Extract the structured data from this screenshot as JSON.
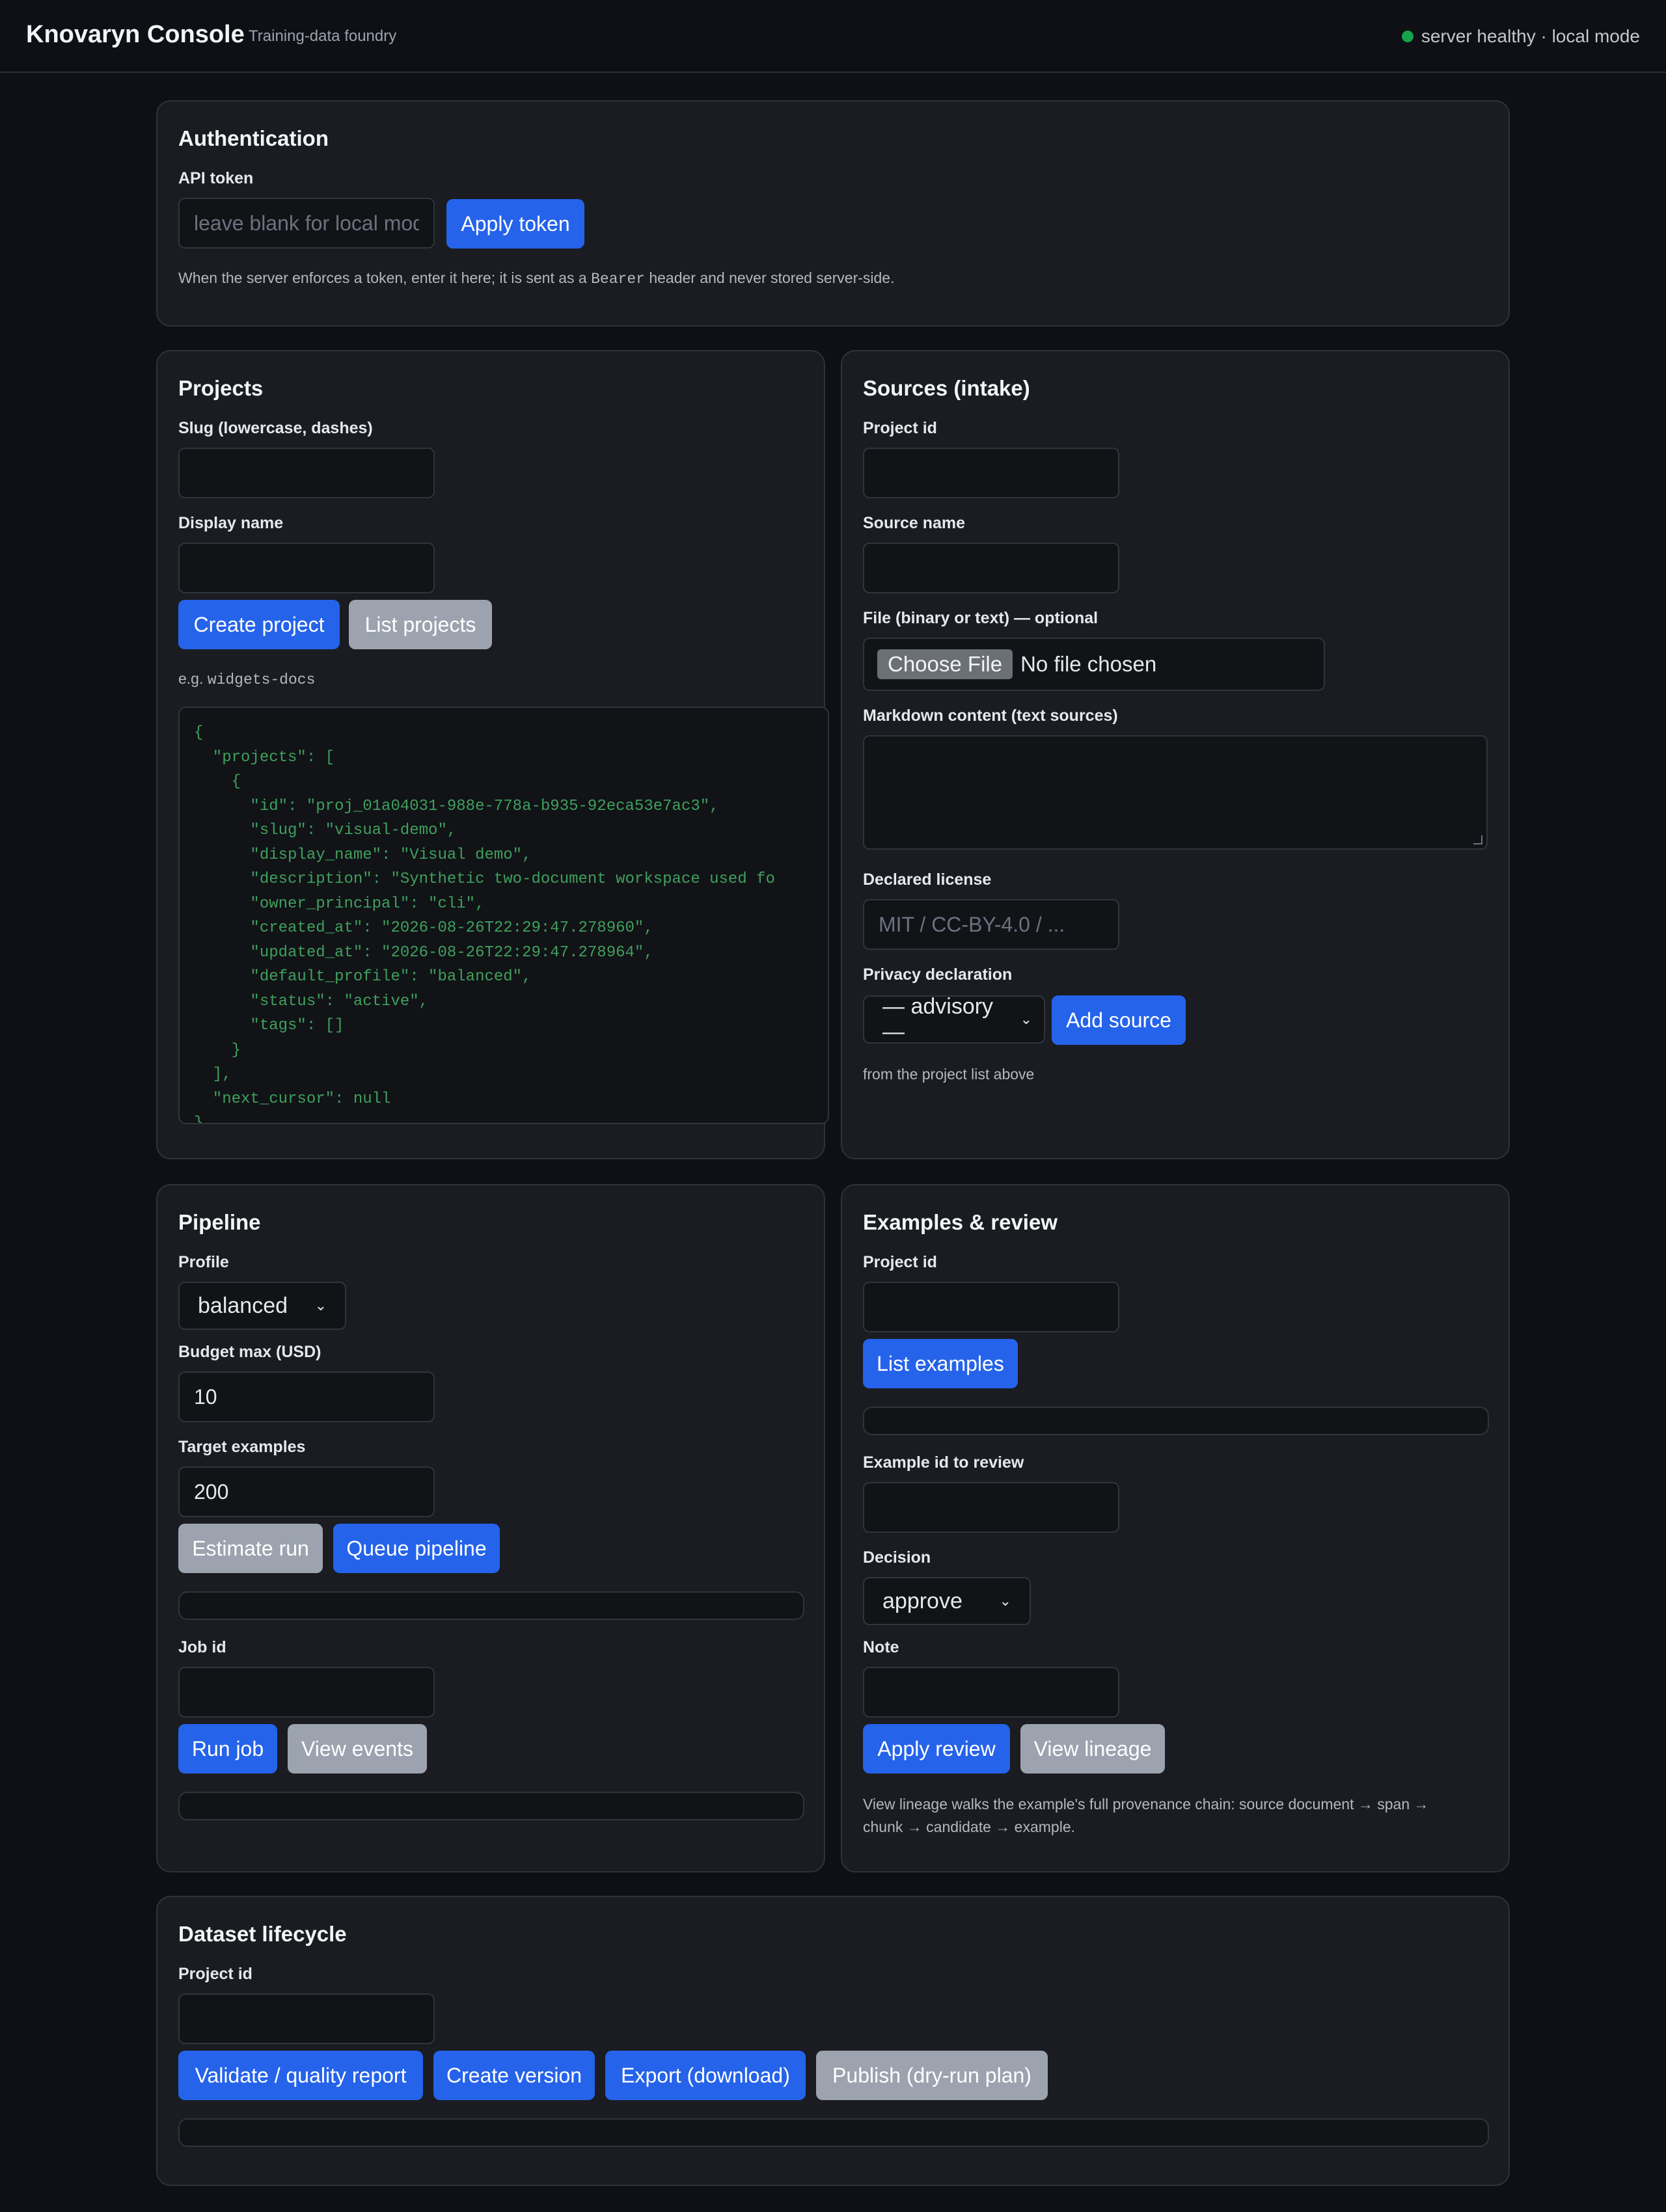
{
  "header": {
    "brand": "Knovaryn Console",
    "tagline": "Training-data foundry",
    "status": "server healthy · local mode",
    "status_color": "#16a34a"
  },
  "auth": {
    "title": "Authentication",
    "token_label": "API token",
    "token_placeholder": "leave blank for local mode",
    "apply_label": "Apply token",
    "hint_before": "When the server enforces a token, enter it here; it is sent as a ",
    "hint_code": "Bearer",
    "hint_after": " header and never stored server-side."
  },
  "projects": {
    "title": "Projects",
    "slug_label": "Slug (lowercase, dashes)",
    "display_label": "Display name",
    "create_label": "Create project",
    "list_label": "List projects",
    "hint_prefix": "e.g. ",
    "hint_code": "widgets-docs",
    "json_lines": [
      "{",
      "  \"projects\": [",
      "    {",
      "      \"id\": \"proj_01a04031-988e-778a-b935-92eca53e7ac3\",",
      "      \"slug\": \"visual-demo\",",
      "      \"display_name\": \"Visual demo\",",
      "      \"description\": \"Synthetic two-document workspace used fo",
      "      \"owner_principal\": \"cli\",",
      "      \"created_at\": \"2026-08-26T22:29:47.278960\",",
      "      \"updated_at\": \"2026-08-26T22:29:47.278964\",",
      "      \"default_profile\": \"balanced\",",
      "      \"status\": \"active\",",
      "      \"tags\": []",
      "    }",
      "  ],",
      "  \"next_cursor\": null",
      "}"
    ]
  },
  "sources": {
    "title": "Sources (intake)",
    "project_label": "Project id",
    "name_label": "Source name",
    "file_label": "File (binary or text) — optional",
    "file_button": "Choose File",
    "file_status": "No file chosen",
    "markdown_label": "Markdown content (text sources)",
    "license_label": "Declared license",
    "license_placeholder": "MIT / CC-BY-4.0 / ...",
    "privacy_label": "Privacy declaration",
    "privacy_value": "— advisory —",
    "add_label": "Add source",
    "hint": "from the project list above"
  },
  "pipeline": {
    "title": "Pipeline",
    "profile_label": "Profile",
    "profile_value": "balanced",
    "budget_label": "Budget max (USD)",
    "budget_value": "10",
    "target_label": "Target examples",
    "target_value": "200",
    "estimate_label": "Estimate run",
    "queue_label": "Queue pipeline",
    "job_label": "Job id",
    "run_label": "Run job",
    "events_label": "View events"
  },
  "examples": {
    "title": "Examples & review",
    "project_label": "Project id",
    "list_label": "List examples",
    "review_id_label": "Example id to review",
    "decision_label": "Decision",
    "decision_value": "approve",
    "note_label": "Note",
    "apply_label": "Apply review",
    "lineage_label": "View lineage",
    "hint_line1": "View lineage walks the example's full provenance chain: source document → span →",
    "hint_line2": "chunk → candidate → example."
  },
  "dataset": {
    "title": "Dataset lifecycle",
    "project_label": "Project id",
    "validate_label": "Validate / quality report",
    "version_label": "Create version",
    "export_label": "Export (download)",
    "publish_label": "Publish (dry-run plan)"
  },
  "colors": {
    "background": "#0e1015",
    "card": "#1a1c21",
    "primary": "#2563eb",
    "secondary": "#9ca3af",
    "json_text": "#3fa05c"
  }
}
